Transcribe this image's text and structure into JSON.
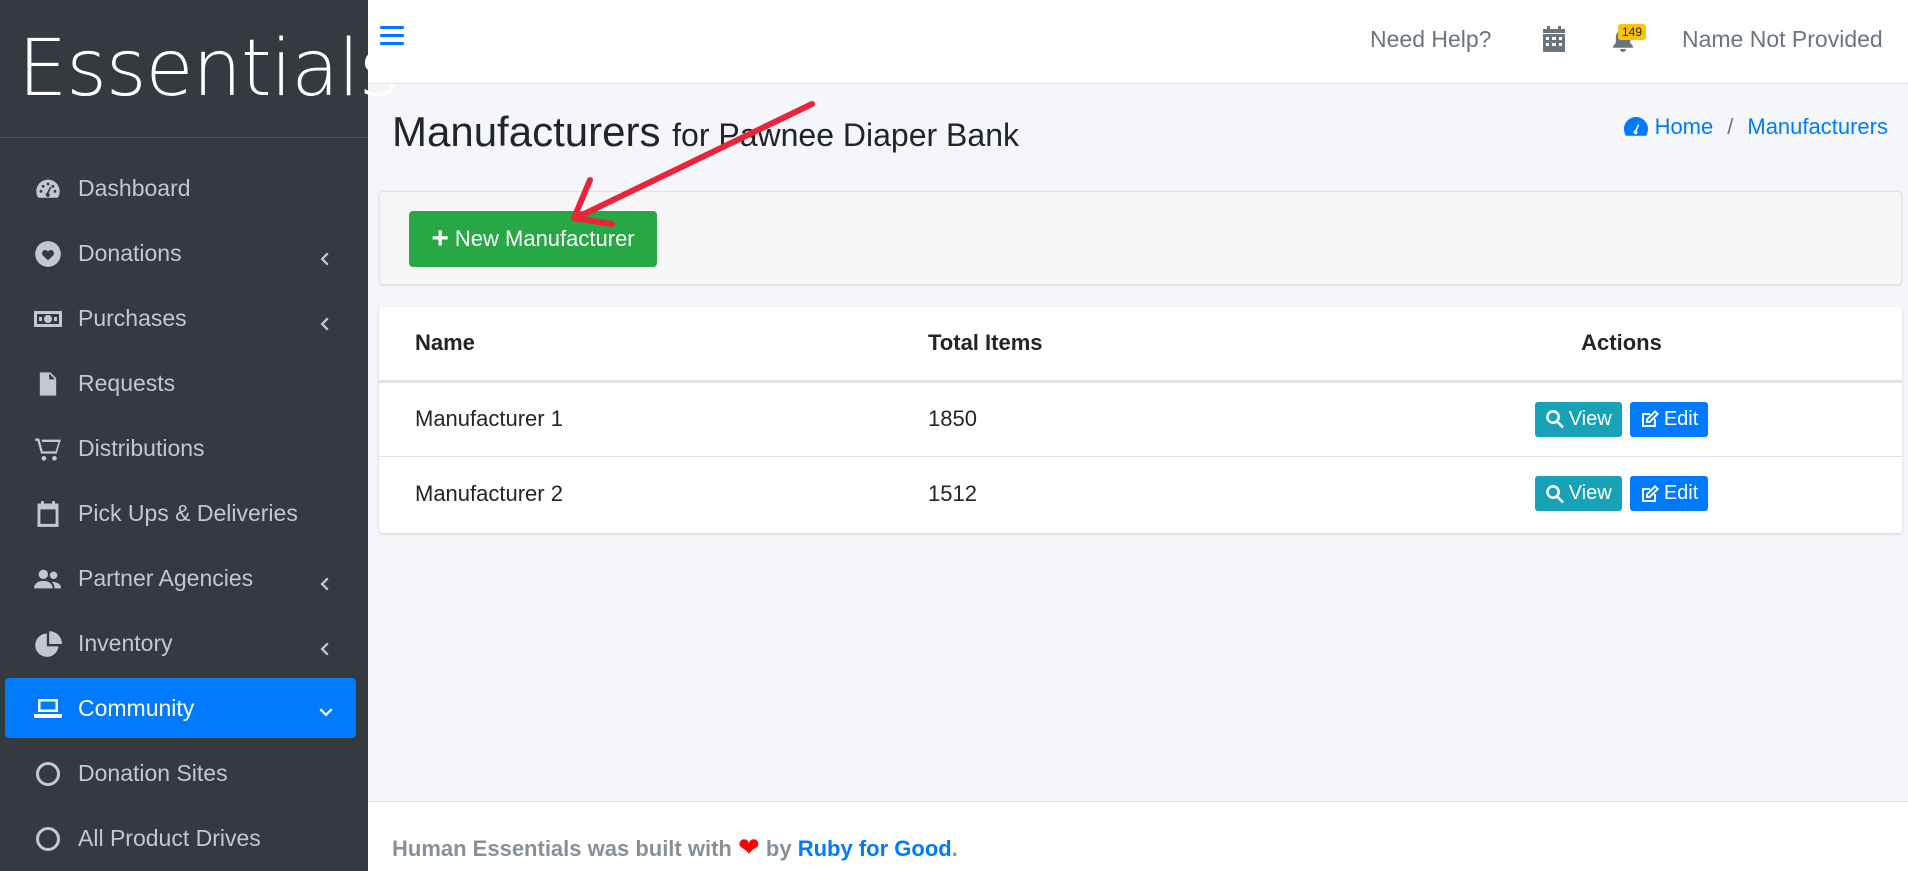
{
  "brand": {
    "name": "Essentials"
  },
  "sidebar": {
    "items": [
      {
        "label": "Dashboard",
        "icon": "dashboard-icon"
      },
      {
        "label": "Donations",
        "icon": "heart-circle-icon",
        "has_children": true
      },
      {
        "label": "Purchases",
        "icon": "money-bill-icon",
        "has_children": true
      },
      {
        "label": "Requests",
        "icon": "file-icon"
      },
      {
        "label": "Distributions",
        "icon": "cart-icon"
      },
      {
        "label": "Pick Ups & Deliveries",
        "icon": "calendar-icon"
      },
      {
        "label": "Partner Agencies",
        "icon": "users-icon",
        "has_children": true
      },
      {
        "label": "Inventory",
        "icon": "pie-chart-icon",
        "has_children": true
      },
      {
        "label": "Community",
        "icon": "laptop-icon",
        "has_children": true,
        "active": true
      },
      {
        "label": "Donation Sites",
        "icon": "circle-icon"
      },
      {
        "label": "All Product Drives",
        "icon": "circle-icon"
      }
    ]
  },
  "topbar": {
    "help": "Need Help?",
    "notification_count": "149",
    "username": "Name Not Provided"
  },
  "header": {
    "title": "Manufacturers",
    "subtitle": "for Pawnee Diaper Bank",
    "breadcrumb": {
      "home": "Home",
      "current": "Manufacturers"
    }
  },
  "actions": {
    "new_label": "New Manufacturer"
  },
  "table": {
    "headers": {
      "name": "Name",
      "total": "Total Items",
      "actions": "Actions"
    },
    "rows": [
      {
        "name": "Manufacturer 1",
        "total": "1850"
      },
      {
        "name": "Manufacturer 2",
        "total": "1512"
      }
    ],
    "view_label": "View",
    "edit_label": "Edit"
  },
  "footer": {
    "text": "Human Essentials was built with",
    "by": "by",
    "link": "Ruby for Good",
    "period": "."
  },
  "colors": {
    "sidebar_bg": "#343a40",
    "accent": "#007bff",
    "success": "#28a745",
    "info": "#17a2b8",
    "annotation": "#e8253b"
  }
}
